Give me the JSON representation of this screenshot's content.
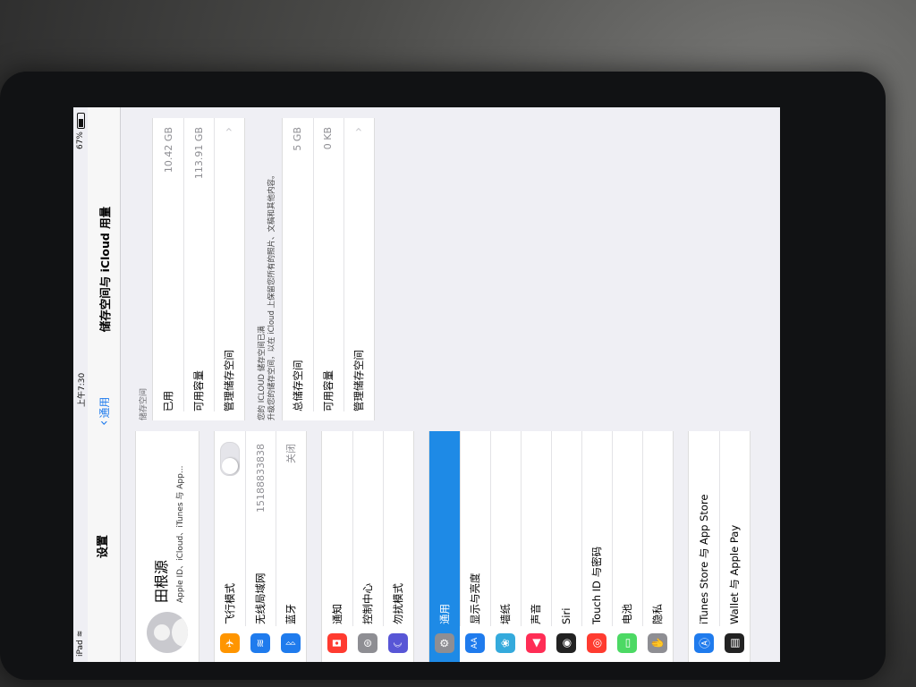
{
  "status_bar": {
    "device": "iPad",
    "time": "上午7:30",
    "battery": "67%"
  },
  "master": {
    "title": "设置",
    "profile": {
      "name": "田根源",
      "subtitle": "Apple ID、iCloud、iTunes 与 App..."
    },
    "group1": [
      {
        "label": "飞行模式",
        "icon": "airplane-icon",
        "color": "#ff9500",
        "glyph": "✈",
        "type": "toggle"
      },
      {
        "label": "无线局域网",
        "icon": "wifi-icon",
        "color": "#1f7bed",
        "glyph": "≋",
        "value": "15188833838"
      },
      {
        "label": "蓝牙",
        "icon": "bluetooth-icon",
        "color": "#1f7bed",
        "glyph": "ᛒ",
        "value": "关闭"
      }
    ],
    "group2": [
      {
        "label": "通知",
        "icon": "notifications-icon",
        "color": "#ff3b30",
        "glyph": "◘"
      },
      {
        "label": "控制中心",
        "icon": "control-center-icon",
        "color": "#8e8e93",
        "glyph": "⊜"
      },
      {
        "label": "勿扰模式",
        "icon": "moon-icon",
        "color": "#5856d6",
        "glyph": "☾"
      }
    ],
    "group3": [
      {
        "label": "通用",
        "icon": "gear-icon",
        "color": "#8e8e93",
        "glyph": "⚙",
        "selected": true
      },
      {
        "label": "显示与亮度",
        "icon": "display-icon",
        "color": "#1f7bed",
        "glyph": "AA"
      },
      {
        "label": "墙纸",
        "icon": "wallpaper-icon",
        "color": "#34aadc",
        "glyph": "❀"
      },
      {
        "label": "声音",
        "icon": "sound-icon",
        "color": "#ff2d55",
        "glyph": "◀"
      },
      {
        "label": "Siri",
        "icon": "siri-icon",
        "color": "#222222",
        "glyph": "◉"
      },
      {
        "label": "Touch ID 与密码",
        "icon": "fingerprint-icon",
        "color": "#ff3b30",
        "glyph": "◎"
      },
      {
        "label": "电池",
        "icon": "battery-icon",
        "color": "#4cd964",
        "glyph": "▭"
      },
      {
        "label": "隐私",
        "icon": "hand-icon",
        "color": "#8e8e93",
        "glyph": "✋"
      }
    ],
    "group4": [
      {
        "label": "iTunes Store 与 App Store",
        "icon": "app-store-icon",
        "color": "#1f7bed",
        "glyph": "Ⓐ"
      },
      {
        "label": "Wallet 与 Apple Pay",
        "icon": "wallet-icon",
        "color": "#222222",
        "glyph": "▤"
      }
    ]
  },
  "detail": {
    "back_label": "通用",
    "title": "储存空间与 iCloud 用量",
    "storage_header": "储存空间",
    "storage_rows": [
      {
        "label": "已用",
        "value": "10.42 GB"
      },
      {
        "label": "可用容量",
        "value": "113.91 GB"
      }
    ],
    "manage_label": "管理储存空间",
    "icloud_note": "您的 ICLOUD 储存空间已满\n升级您的储存空间，以在 iCloud 上保留您所有的照片、文稿和其他内容。",
    "icloud_rows": [
      {
        "label": "总储存空间",
        "value": "5 GB"
      },
      {
        "label": "可用容量",
        "value": "0 KB"
      }
    ],
    "icloud_manage_label": "管理储存空间"
  }
}
